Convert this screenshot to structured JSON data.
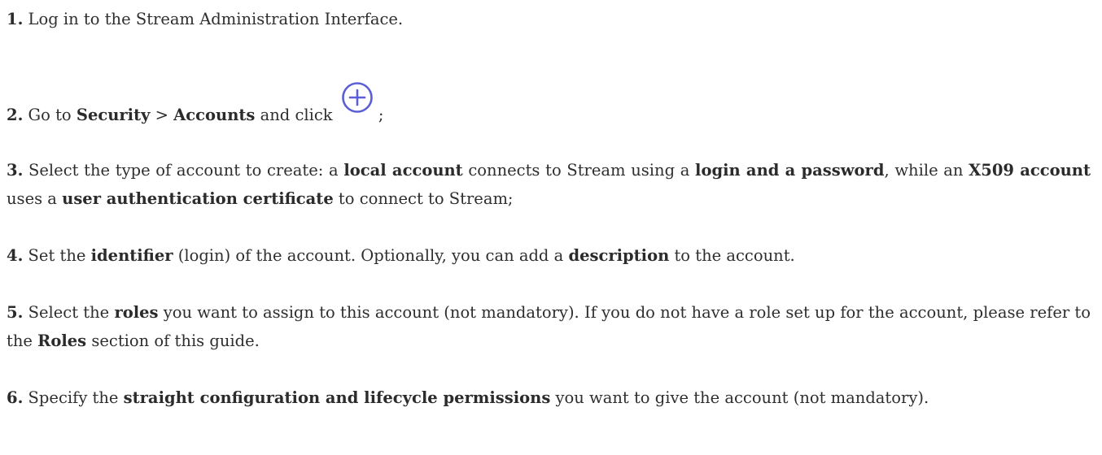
{
  "steps": [
    {
      "num": "1.",
      "parts": [
        " Log in to the Stream Administration Interface."
      ]
    },
    {
      "num": "2.",
      "t1": " Go to ",
      "b1": "Security",
      "t2": " > ",
      "b2": "Accounts",
      "t3": " and click ",
      "icon": "add-circle-icon",
      "t4": ";"
    },
    {
      "num": "3.",
      "t1": " Select the type of account to create: a ",
      "b1": "local account",
      "t2": " connects to Stream using a ",
      "b2": "login and a password",
      "t3": ", while an ",
      "b3": "X509 account",
      "t4": " uses a ",
      "b4": "user authentication certificate",
      "t5": " to connect to Stream;"
    },
    {
      "num": "4.",
      "t1": " Set the ",
      "b1": "identifier",
      "t2": " (login) of the account. Optionally, you can add a ",
      "b2": "description",
      "t3": " to the account."
    },
    {
      "num": "5.",
      "t1": " Select the ",
      "b1": "roles",
      "t2": " you want to assign to this account (not mandatory). If you do not have a role set up for the account, please refer to the ",
      "b2": "Roles",
      "t3": " section of this guide."
    },
    {
      "num": "6.",
      "t1": " Specify the ",
      "b1": "straight configuration and lifecycle permissions",
      "t2": " you want to give the account (not mandatory)."
    }
  ],
  "colors": {
    "text": "#2e2e2e",
    "icon_accent": "#5b5fd6"
  }
}
